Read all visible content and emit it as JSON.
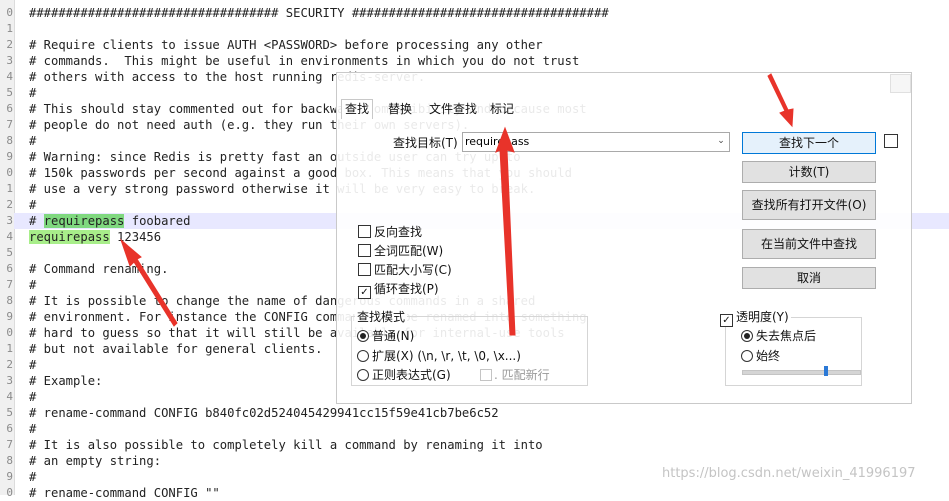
{
  "editor": {
    "gutter_numbers": [
      "0",
      "1",
      "2",
      "3",
      "4",
      "5",
      "6",
      "7",
      "8",
      "9",
      "0",
      "1",
      "2",
      "3",
      "4",
      "5",
      "6",
      "7",
      "8",
      "9",
      "0",
      "1",
      "2",
      "3",
      "4",
      "5",
      "6",
      "7",
      "8",
      "9",
      "0"
    ],
    "lines": [
      "################################## SECURITY ###################################",
      "",
      "# Require clients to issue AUTH <PASSWORD> before processing any other",
      "# commands.  This might be useful in environments in which you do not trust",
      "# others with access to the host running redis-server.",
      "#",
      "# This should stay commented out for backward compatibility and because most",
      "# people do not need auth (e.g. they run their own servers).",
      "#",
      "# Warning: since Redis is pretty fast an outside user can try up to",
      "# 150k passwords per second against a good box. This means that you should",
      "# use a very strong password otherwise it will be very easy to break.",
      "#",
      "",
      "",
      "",
      "# Command renaming.",
      "#",
      "# It is possible to change the name of dangerous commands in a shared",
      "# environment. For instance the CONFIG command may be renamed into something",
      "# hard to guess so that it will still be available for internal-use tools",
      "# but not available for general clients.",
      "#",
      "# Example:",
      "#",
      "# rename-command CONFIG b840fc02d524045429941cc15f59e41cb7be6c52",
      "#",
      "# It is also possible to completely kill a command by renaming it into",
      "# an empty string:",
      "#",
      "# rename-command CONFIG \"\""
    ],
    "commented_line": {
      "prefix": "# ",
      "match": "requirepass",
      "rest": " foobared"
    },
    "active_line": {
      "match": "requirepass",
      "rest": " 123456"
    }
  },
  "find_dialog": {
    "tabs": [
      "查找",
      "替换",
      "文件查找",
      "标记"
    ],
    "target_label": "查找目标(T) :",
    "search_value": "requirepass",
    "buttons": {
      "find_next": "查找下一个",
      "count": "计数(T)",
      "find_all_open": "查找所有打开文件(O)",
      "find_in_current": "在当前文件中查找",
      "cancel": "取消"
    },
    "options": [
      {
        "label": "反向查找",
        "checked": false
      },
      {
        "label": "全词匹配(W)",
        "checked": false
      },
      {
        "label": "匹配大小写(C)",
        "checked": false
      },
      {
        "label": "循环查找(P)",
        "checked": true
      }
    ],
    "search_mode": {
      "title": "查找模式",
      "options": [
        "普通(N)",
        "扩展(X) (\\n, \\r, \\t, \\0, \\x...)",
        "正则表达式(G)"
      ],
      "selected_index": 0,
      "dot_matches_newline": ". 匹配新行"
    },
    "transparency": {
      "label": "透明度(Y)",
      "checked": true,
      "options": [
        "失去焦点后",
        "始终"
      ],
      "selected_index": 0,
      "level": 0.71
    }
  },
  "watermark": "https://blog.csdn.net/weixin_41996197",
  "colors": {
    "match_highlight": "#7fd87f",
    "arrow": "#e8332a",
    "active_line": "#e8e8ff"
  }
}
